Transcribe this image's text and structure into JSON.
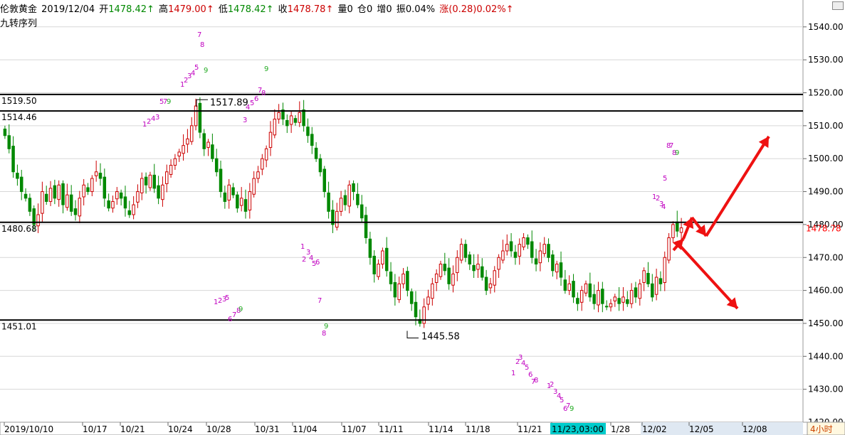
{
  "header": {
    "symbol": "伦敦黄金",
    "date": "2019/12/04",
    "open_label": "开",
    "open": "1478.42↑",
    "high_label": "高",
    "high": "1479.00↑",
    "low_label": "低",
    "low": "1478.42↑",
    "close_label": "收",
    "close": "1478.78↑",
    "vol_label": "量",
    "vol": "0",
    "oi_label": "仓",
    "oi": "0",
    "inc_label": "增",
    "inc": "0",
    "amp_label": "振",
    "amp": "0.04%",
    "chg_label": "涨",
    "chg": "(0.28)0.02%↑",
    "indicator": "九转序列"
  },
  "colors": {
    "up": "#cc0000",
    "down": "#008800",
    "text": "#000000",
    "grid": "#d7d7d7",
    "magenta": "#c000c0",
    "green_mark": "#22aa22",
    "arrow": "#ee1111",
    "highlight": "#00cccc",
    "axis_bg": "#dfe8f2",
    "current": "#ff0000"
  },
  "chart_data": {
    "type": "candlestick",
    "ylim": [
      1420,
      1546
    ],
    "y_ticks": [
      "1540.00",
      "1530.00",
      "1520.00",
      "1510.00",
      "1500.00",
      "1490.00",
      "1480.00",
      "1470.00",
      "1460.00",
      "1450.00",
      "1440.00",
      "1430.00",
      "1420.00"
    ],
    "x_labels": [
      "2019/10/10",
      "10/17",
      "10/21",
      "10/24",
      "10/28",
      "10/31",
      "11/04",
      "11/07",
      "11/11",
      "11/14",
      "11/18",
      "11/21",
      "11/23,03:00",
      "1/28",
      "12/02",
      "12/05",
      "12/08"
    ],
    "highlighted_x_label": "11/23,03:00",
    "timeframe": "4小时",
    "current_price": "1478.78",
    "horizontal_levels": [
      {
        "value": 1519.5,
        "label": "1519.50"
      },
      {
        "value": 1514.46,
        "label": "1514.46"
      },
      {
        "value": 1480.68,
        "label": "1480.68"
      },
      {
        "value": 1451.01,
        "label": "1451.01"
      }
    ],
    "annotations": [
      {
        "label": "1517.89",
        "value": 1517.89
      },
      {
        "label": "1445.58",
        "value": 1445.58
      }
    ],
    "series_close": [
      1507,
      1503,
      1496,
      1494,
      1490,
      1488,
      1484,
      1480,
      1483,
      1490,
      1487,
      1491,
      1488,
      1492,
      1486,
      1489,
      1484,
      1483,
      1488,
      1492,
      1490,
      1494,
      1496,
      1494,
      1488,
      1485,
      1487,
      1490,
      1488,
      1485,
      1483,
      1486,
      1490,
      1494,
      1492,
      1495,
      1491,
      1488,
      1492,
      1496,
      1498,
      1500,
      1502,
      1504,
      1506,
      1510,
      1516,
      1508,
      1503,
      1505,
      1500,
      1496,
      1490,
      1487,
      1492,
      1489,
      1485,
      1488,
      1484,
      1490,
      1494,
      1496,
      1500,
      1503,
      1508,
      1512,
      1514,
      1512,
      1510,
      1513,
      1511,
      1514,
      1510,
      1507,
      1504,
      1500,
      1496,
      1490,
      1484,
      1480,
      1484,
      1488,
      1486,
      1492,
      1490,
      1486,
      1482,
      1476,
      1470,
      1465,
      1468,
      1472,
      1466,
      1462,
      1458,
      1462,
      1465,
      1460,
      1456,
      1452,
      1450,
      1455,
      1458,
      1462,
      1465,
      1468,
      1466,
      1462,
      1465,
      1470,
      1474,
      1470,
      1468,
      1466,
      1468,
      1464,
      1460,
      1462,
      1466,
      1470,
      1472,
      1474,
      1472,
      1470,
      1474,
      1476,
      1474,
      1470,
      1468,
      1472,
      1474,
      1470,
      1466,
      1468,
      1464,
      1460,
      1462,
      1458,
      1456,
      1460,
      1462,
      1458,
      1456,
      1460,
      1456,
      1455,
      1456,
      1458,
      1456,
      1458,
      1456,
      1460,
      1458,
      1462,
      1466,
      1462,
      1458,
      1464,
      1462,
      1470,
      1476,
      1480,
      1478,
      1479
    ],
    "td_sequence": {
      "top_counts": [
        "1",
        "2",
        "3",
        "4",
        "5",
        "6",
        "7",
        "8",
        "9"
      ],
      "bottom_counts": [
        "1",
        "2",
        "3",
        "4",
        "5",
        "6",
        "7",
        "8",
        "9"
      ]
    },
    "forecast_arrows": [
      {
        "name": "up-then-down-then-up",
        "points": [
          [
            1478,
            0
          ],
          [
            1487,
            1
          ],
          [
            1481,
            2
          ],
          [
            1514,
            3
          ]
        ]
      },
      {
        "name": "down-branch",
        "points": [
          [
            1478,
            0
          ],
          [
            1458,
            1
          ]
        ]
      }
    ]
  }
}
